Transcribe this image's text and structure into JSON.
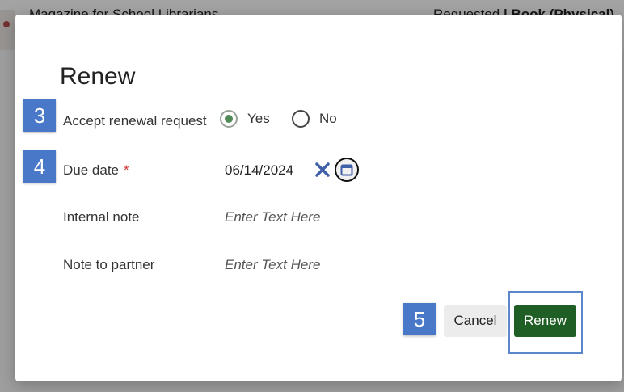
{
  "background": {
    "record_title": "Magazine for School Librarians",
    "record_type_prefix": "Requested",
    "record_type_value": "Book (Physical)"
  },
  "modal": {
    "title": "Renew",
    "accept_renewal": {
      "label": "Accept renewal request",
      "options": [
        "Yes",
        "No"
      ],
      "selected": "Yes"
    },
    "due_date": {
      "label": "Due date",
      "required_marker": "*",
      "value": "06/14/2024",
      "clear_icon": "close-x-icon",
      "calendar_icon": "calendar-icon"
    },
    "internal_note": {
      "label": "Internal note",
      "placeholder": "Enter Text Here"
    },
    "note_to_partner": {
      "label": "Note to partner",
      "placeholder": "Enter Text Here"
    },
    "buttons": {
      "cancel": "Cancel",
      "renew": "Renew"
    }
  },
  "steps": {
    "step_accept": "3",
    "step_due": "4",
    "step_renew": "5"
  },
  "colors": {
    "renew_button": "#1f5e24",
    "badge": "#4a78c9",
    "radio_selected": "#4f8a57",
    "clear_icon": "#3f5fa8",
    "highlight": "#5b86c9",
    "required": "#d32f2f"
  }
}
